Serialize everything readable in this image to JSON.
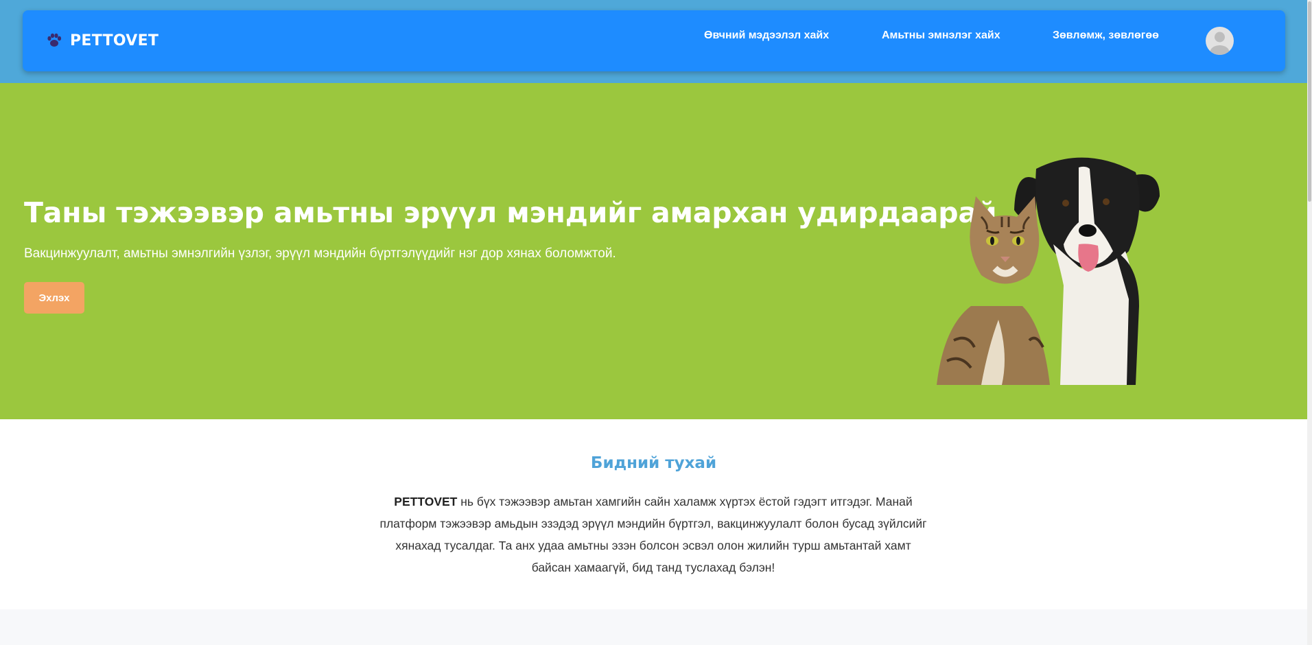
{
  "brand": {
    "name": "PETTOVET",
    "icon": "paw-icon"
  },
  "nav": {
    "links": [
      {
        "label": "Өвчний мэдээлэл хайх"
      },
      {
        "label": "Амьтны эмнэлэг хайх"
      },
      {
        "label": "Зөвлөмж, зөвлөгөө"
      }
    ],
    "avatar_icon": "user-avatar-icon"
  },
  "hero": {
    "title": "Таны тэжээвэр амьтны эрүүл мэндийг амархан удирдаарай",
    "subtitle": "Вакцинжуулалт, амьтны эмнэлгийн үзлэг, эрүүл мэндийн бүртгэлүүдийг нэг дор хянах боломжтой.",
    "cta_label": "Эхлэх",
    "image": "cat-and-dog-photo"
  },
  "about": {
    "title": "Бидний тухай",
    "brand_word": "PETTOVET",
    "body": " нь бүх тэжээвэр амьтан хамгийн сайн халамж хүртэх ёстой гэдэгт итгэдэг. Манай платформ тэжээвэр амьдын эзэдэд эрүүл мэндийн бүртгэл, вакцинжуулалт болон бусад зүйлсийг хянахад тусалдаг. Та анх удаа амьтны эзэн болсон эсвэл олон жилийн турш амьтантай хамт байсан хамаагүй, бид танд туслахад бэлэн!"
  },
  "colors": {
    "nav_band": "#4fa8d9",
    "navbar": "#1e8cff",
    "hero_bg": "#9bc73e",
    "cta": "#f3a463",
    "about_title": "#4fa3d8"
  }
}
